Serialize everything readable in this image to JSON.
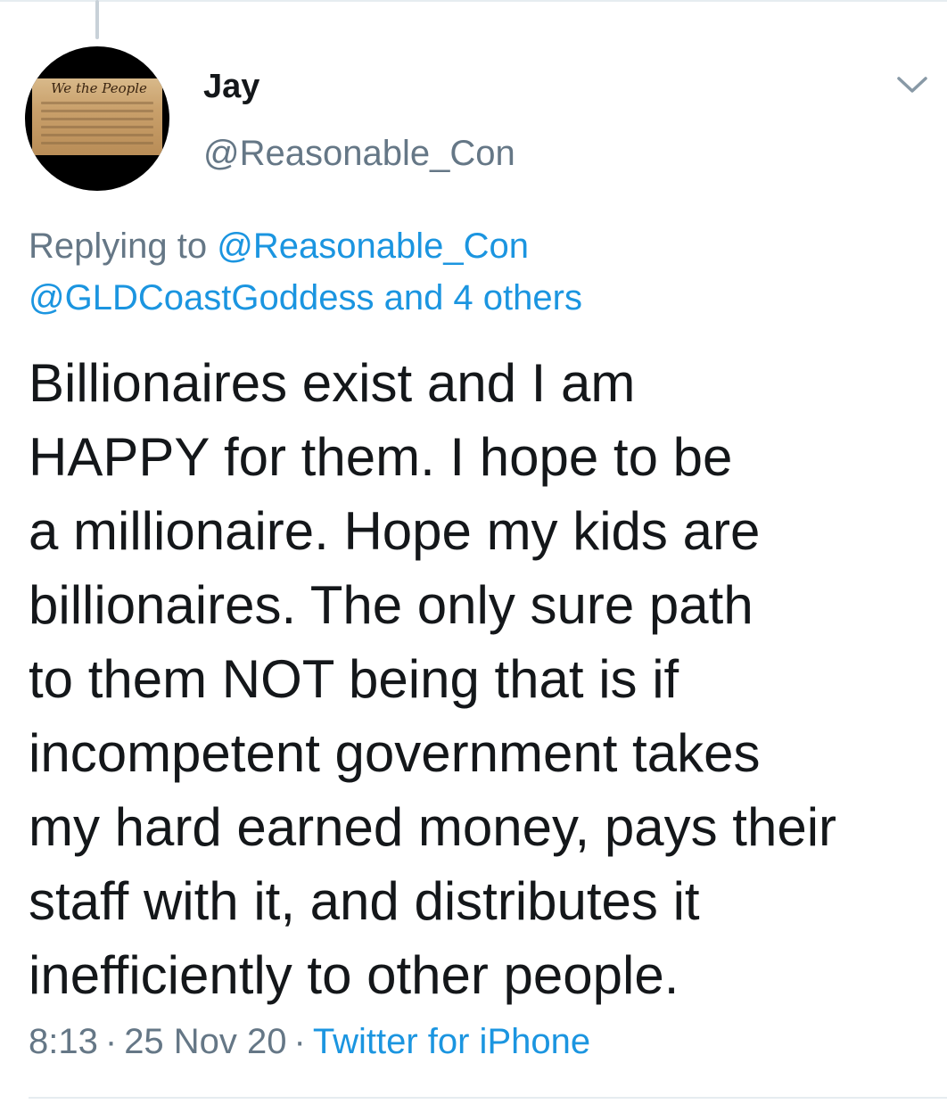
{
  "tweet": {
    "author_name": "Jay",
    "author_handle": "@Reasonable_Con",
    "avatar_text": "We the People",
    "replying_prefix": "Replying to",
    "replying_handle": "@Reasonable_Con",
    "replying_line2_handle": "@GLDCoastGoddess",
    "replying_line2_suffix": "and 4 others",
    "text_lines": [
      "Billionaires exist and I am",
      "HAPPY for them. I hope to be",
      "a millionaire. Hope my kids are",
      "billionaires. The only sure path",
      "to them NOT being that is if",
      "incompetent government takes",
      "my hard earned money, pays their",
      "staff with it, and distributes it",
      "inefficiently to other people."
    ],
    "time": "8:13",
    "separator": "·",
    "date": "25 Nov 20",
    "source": "Twitter for iPhone"
  },
  "colors": {
    "text": "#14171a",
    "secondary": "#657786",
    "link": "#1b95e0",
    "border": "#e6ecf0"
  },
  "icons": {
    "more_menu": "chevron-down-icon"
  }
}
